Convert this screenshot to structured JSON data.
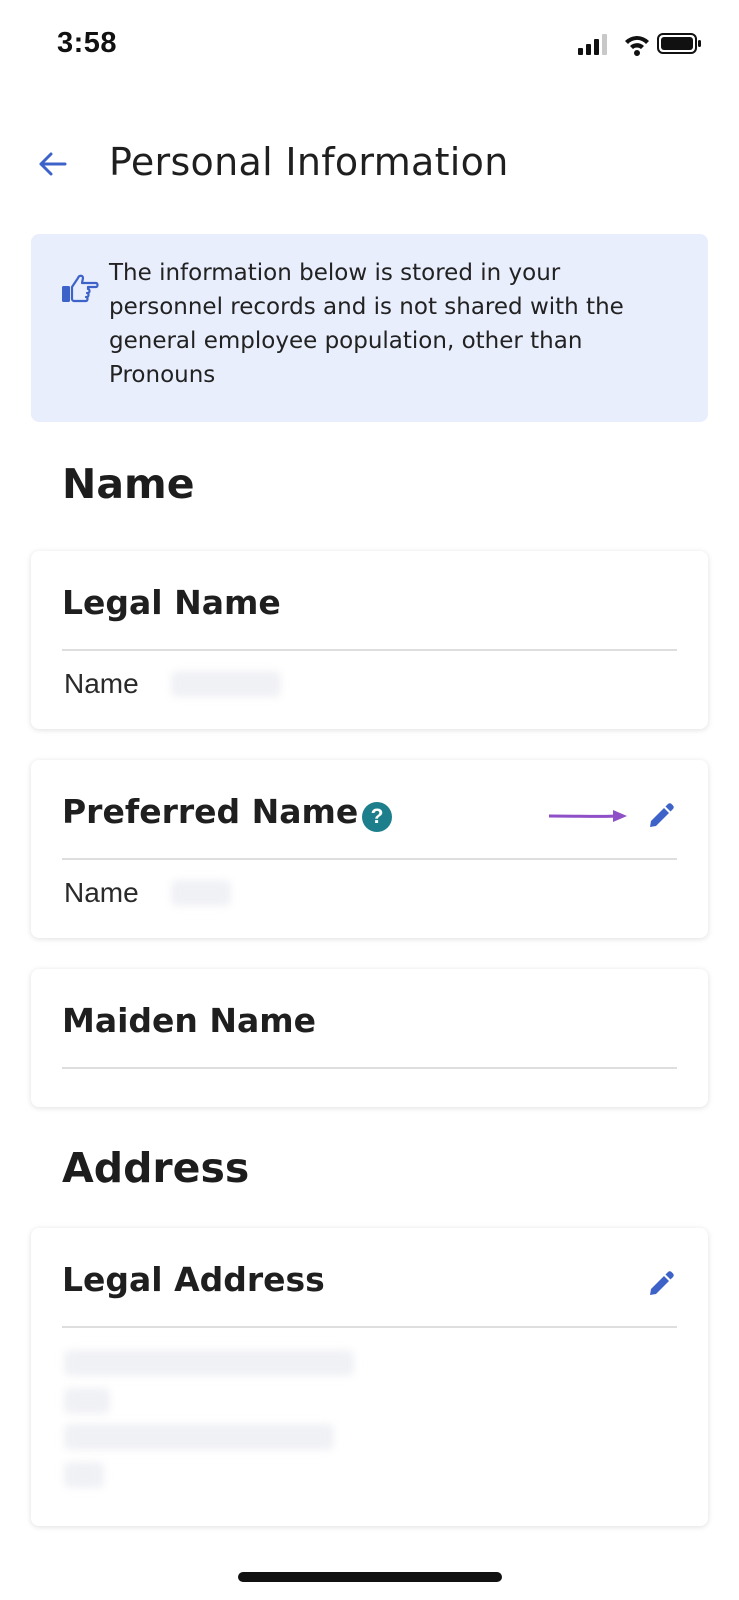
{
  "status_bar": {
    "time": "3:58"
  },
  "header": {
    "title": "Personal Information",
    "back_icon": "arrow-left-icon"
  },
  "banner": {
    "icon": "thumbs-up-pointing-icon",
    "text": "The information below is stored in your personnel records and is not shared with the general employee population, other than Pronouns",
    "background": "#e9eefd"
  },
  "sections": {
    "name_heading": "Name",
    "address_heading": "Address"
  },
  "cards": {
    "legal_name": {
      "title": "Legal Name",
      "value_label": "Name"
    },
    "preferred_name": {
      "title": "Preferred Name",
      "help_icon_glyph": "?",
      "value_label": "Name",
      "edit_icon": "pencil-icon"
    },
    "maiden_name": {
      "title": "Maiden Name"
    },
    "legal_address": {
      "title": "Legal Address",
      "edit_icon": "pencil-icon"
    }
  },
  "colors": {
    "accent_blue": "#3d63c9",
    "help_teal": "#1e7f8c",
    "annotation_purple": "#8e4fc7"
  }
}
